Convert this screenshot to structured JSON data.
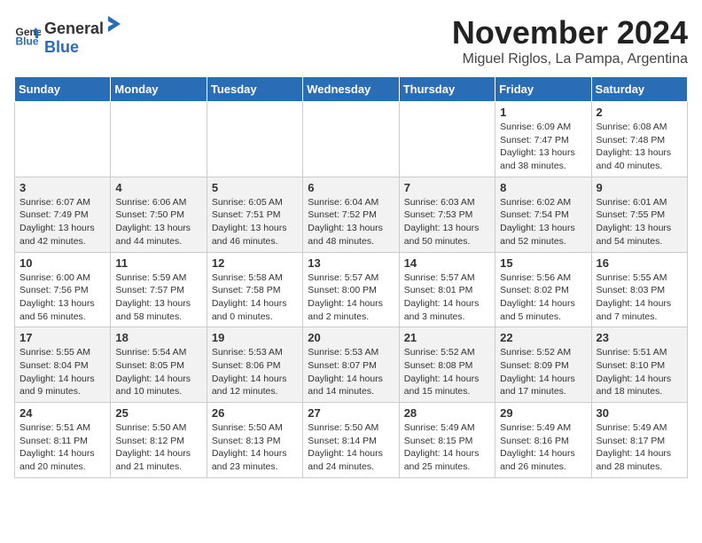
{
  "header": {
    "logo_general": "General",
    "logo_blue": "Blue",
    "month_title": "November 2024",
    "location": "Miguel Riglos, La Pampa, Argentina"
  },
  "weekdays": [
    "Sunday",
    "Monday",
    "Tuesday",
    "Wednesday",
    "Thursday",
    "Friday",
    "Saturday"
  ],
  "weeks": [
    [
      {
        "day": "",
        "info": ""
      },
      {
        "day": "",
        "info": ""
      },
      {
        "day": "",
        "info": ""
      },
      {
        "day": "",
        "info": ""
      },
      {
        "day": "",
        "info": ""
      },
      {
        "day": "1",
        "info": "Sunrise: 6:09 AM\nSunset: 7:47 PM\nDaylight: 13 hours\nand 38 minutes."
      },
      {
        "day": "2",
        "info": "Sunrise: 6:08 AM\nSunset: 7:48 PM\nDaylight: 13 hours\nand 40 minutes."
      }
    ],
    [
      {
        "day": "3",
        "info": "Sunrise: 6:07 AM\nSunset: 7:49 PM\nDaylight: 13 hours\nand 42 minutes."
      },
      {
        "day": "4",
        "info": "Sunrise: 6:06 AM\nSunset: 7:50 PM\nDaylight: 13 hours\nand 44 minutes."
      },
      {
        "day": "5",
        "info": "Sunrise: 6:05 AM\nSunset: 7:51 PM\nDaylight: 13 hours\nand 46 minutes."
      },
      {
        "day": "6",
        "info": "Sunrise: 6:04 AM\nSunset: 7:52 PM\nDaylight: 13 hours\nand 48 minutes."
      },
      {
        "day": "7",
        "info": "Sunrise: 6:03 AM\nSunset: 7:53 PM\nDaylight: 13 hours\nand 50 minutes."
      },
      {
        "day": "8",
        "info": "Sunrise: 6:02 AM\nSunset: 7:54 PM\nDaylight: 13 hours\nand 52 minutes."
      },
      {
        "day": "9",
        "info": "Sunrise: 6:01 AM\nSunset: 7:55 PM\nDaylight: 13 hours\nand 54 minutes."
      }
    ],
    [
      {
        "day": "10",
        "info": "Sunrise: 6:00 AM\nSunset: 7:56 PM\nDaylight: 13 hours\nand 56 minutes."
      },
      {
        "day": "11",
        "info": "Sunrise: 5:59 AM\nSunset: 7:57 PM\nDaylight: 13 hours\nand 58 minutes."
      },
      {
        "day": "12",
        "info": "Sunrise: 5:58 AM\nSunset: 7:58 PM\nDaylight: 14 hours\nand 0 minutes."
      },
      {
        "day": "13",
        "info": "Sunrise: 5:57 AM\nSunset: 8:00 PM\nDaylight: 14 hours\nand 2 minutes."
      },
      {
        "day": "14",
        "info": "Sunrise: 5:57 AM\nSunset: 8:01 PM\nDaylight: 14 hours\nand 3 minutes."
      },
      {
        "day": "15",
        "info": "Sunrise: 5:56 AM\nSunset: 8:02 PM\nDaylight: 14 hours\nand 5 minutes."
      },
      {
        "day": "16",
        "info": "Sunrise: 5:55 AM\nSunset: 8:03 PM\nDaylight: 14 hours\nand 7 minutes."
      }
    ],
    [
      {
        "day": "17",
        "info": "Sunrise: 5:55 AM\nSunset: 8:04 PM\nDaylight: 14 hours\nand 9 minutes."
      },
      {
        "day": "18",
        "info": "Sunrise: 5:54 AM\nSunset: 8:05 PM\nDaylight: 14 hours\nand 10 minutes."
      },
      {
        "day": "19",
        "info": "Sunrise: 5:53 AM\nSunset: 8:06 PM\nDaylight: 14 hours\nand 12 minutes."
      },
      {
        "day": "20",
        "info": "Sunrise: 5:53 AM\nSunset: 8:07 PM\nDaylight: 14 hours\nand 14 minutes."
      },
      {
        "day": "21",
        "info": "Sunrise: 5:52 AM\nSunset: 8:08 PM\nDaylight: 14 hours\nand 15 minutes."
      },
      {
        "day": "22",
        "info": "Sunrise: 5:52 AM\nSunset: 8:09 PM\nDaylight: 14 hours\nand 17 minutes."
      },
      {
        "day": "23",
        "info": "Sunrise: 5:51 AM\nSunset: 8:10 PM\nDaylight: 14 hours\nand 18 minutes."
      }
    ],
    [
      {
        "day": "24",
        "info": "Sunrise: 5:51 AM\nSunset: 8:11 PM\nDaylight: 14 hours\nand 20 minutes."
      },
      {
        "day": "25",
        "info": "Sunrise: 5:50 AM\nSunset: 8:12 PM\nDaylight: 14 hours\nand 21 minutes."
      },
      {
        "day": "26",
        "info": "Sunrise: 5:50 AM\nSunset: 8:13 PM\nDaylight: 14 hours\nand 23 minutes."
      },
      {
        "day": "27",
        "info": "Sunrise: 5:50 AM\nSunset: 8:14 PM\nDaylight: 14 hours\nand 24 minutes."
      },
      {
        "day": "28",
        "info": "Sunrise: 5:49 AM\nSunset: 8:15 PM\nDaylight: 14 hours\nand 25 minutes."
      },
      {
        "day": "29",
        "info": "Sunrise: 5:49 AM\nSunset: 8:16 PM\nDaylight: 14 hours\nand 26 minutes."
      },
      {
        "day": "30",
        "info": "Sunrise: 5:49 AM\nSunset: 8:17 PM\nDaylight: 14 hours\nand 28 minutes."
      }
    ]
  ]
}
